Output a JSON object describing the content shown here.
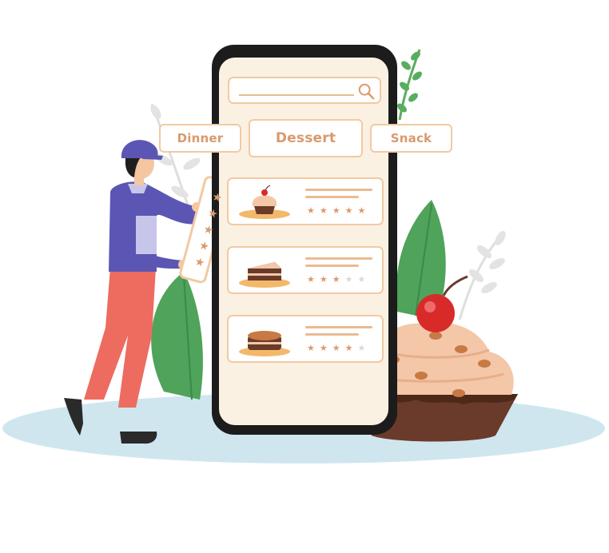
{
  "search": {
    "placeholder": ""
  },
  "categories": [
    {
      "label": "Dinner"
    },
    {
      "label": "Dessert"
    },
    {
      "label": "Snack"
    }
  ],
  "desserts": [
    {
      "item": "cupcake",
      "rating": 5
    },
    {
      "item": "cake-slice",
      "rating": 3
    },
    {
      "item": "chocolate-cake",
      "rating": 4
    }
  ],
  "colors": {
    "accent": "#d99a6c",
    "border": "#f3c9a2",
    "screen": "#fbf1e3",
    "ground": "#cfe6ef",
    "star_off": "#d9d9d9"
  }
}
